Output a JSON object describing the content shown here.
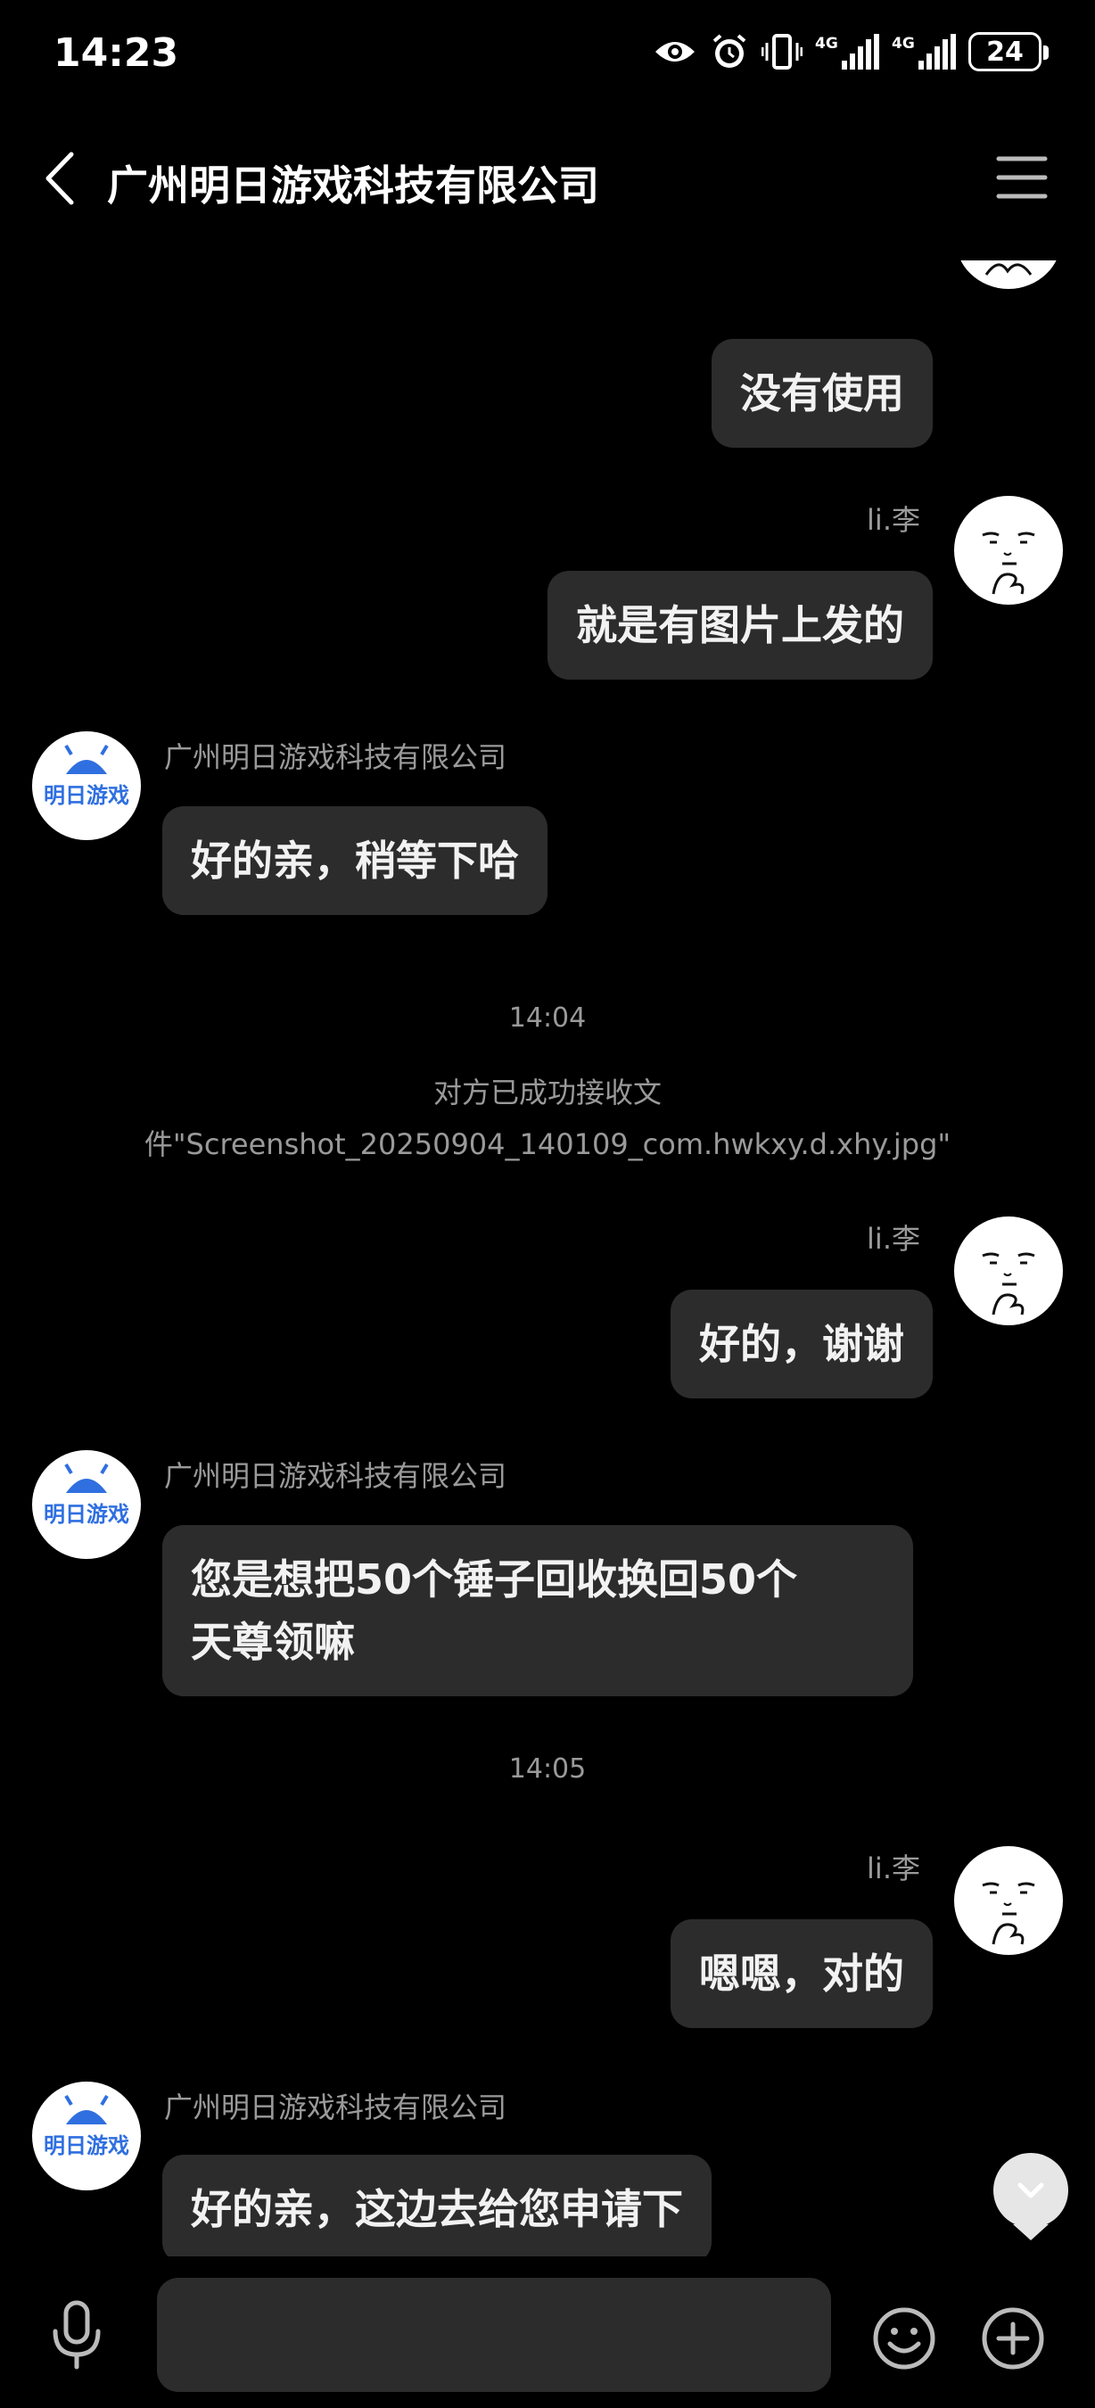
{
  "status_bar": {
    "time": "14:23",
    "battery": "24"
  },
  "header": {
    "title": "广州明日游戏科技有限公司"
  },
  "company": {
    "name": "广州明日游戏科技有限公司",
    "logo_text": "明日游戏",
    "logo_color": "#2f6fe0"
  },
  "user": {
    "name": "li.李"
  },
  "messages": [
    {
      "side": "right",
      "text": "没有使用"
    },
    {
      "side": "right",
      "text": "就是有图片上发的"
    },
    {
      "side": "left",
      "text": "好的亲，稍等下哈"
    },
    {
      "side": "right",
      "text": "好的，谢谢"
    },
    {
      "side": "left",
      "line1": "您是想把50个锤子回收换回50个",
      "line2": "天尊领嘛"
    },
    {
      "side": "right",
      "text": "嗯嗯，对的"
    },
    {
      "side": "left",
      "text": "好的亲，这边去给您申请下"
    }
  ],
  "timestamps": [
    "14:04",
    "14:05"
  ],
  "system": {
    "line1": "对方已成功接收文",
    "line2": "件\"Screenshot_20250904_140109_com.hwkxy.d.xhy.jpg\""
  },
  "input": {
    "value": "",
    "placeholder": ""
  },
  "icons": [
    "back-icon",
    "menu-icon",
    "eye-icon",
    "alarm-icon",
    "vibrate-icon",
    "signal-icon",
    "battery-icon",
    "mic-icon",
    "emoji-icon",
    "plus-icon",
    "chevron-down-icon"
  ],
  "colors": {
    "background": "#000000",
    "bubble": "#2c2c2c",
    "meta_text": "#9a9a9a"
  }
}
